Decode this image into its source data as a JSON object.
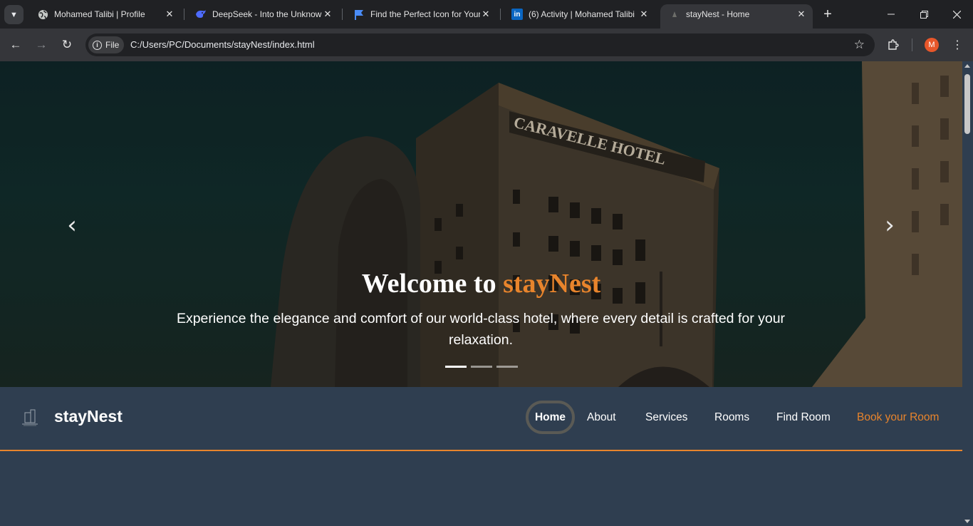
{
  "browser": {
    "tabs": [
      {
        "title": "Mohamed Talibi | Profile",
        "icon": "globe-icon"
      },
      {
        "title": "DeepSeek - Into the Unknown",
        "icon": "deepseek-icon"
      },
      {
        "title": "Find the Perfect Icon for Your",
        "icon": "flag-icon"
      },
      {
        "title": "(6) Activity | Mohamed Talibi",
        "icon": "linkedin-icon",
        "icon_text": "in"
      },
      {
        "title": "stayNest - Home",
        "icon": "site-icon"
      }
    ],
    "address": {
      "scheme_label": "File",
      "url": "C:/Users/PC/Documents/stayNest/index.html"
    },
    "profile_initial": "M"
  },
  "hero": {
    "heading_prefix": "Welcome to ",
    "heading_brand": "stayNest",
    "subtitle": "Experience the elegance and comfort of our world-class hotel, where every detail is crafted for your relaxation.",
    "building_sign": "CARAVELLE HOTEL",
    "slides_count": 3,
    "active_slide": 1
  },
  "navbar": {
    "brand": "stayNest",
    "links": [
      "Home",
      "About",
      "Services",
      "Rooms",
      "Find Room",
      "Book your Room"
    ],
    "active": "Home"
  },
  "colors": {
    "accent": "#e8842c",
    "navbar_bg": "#2f3e50",
    "chrome_bg": "#202124",
    "toolbar_bg": "#35363a"
  }
}
